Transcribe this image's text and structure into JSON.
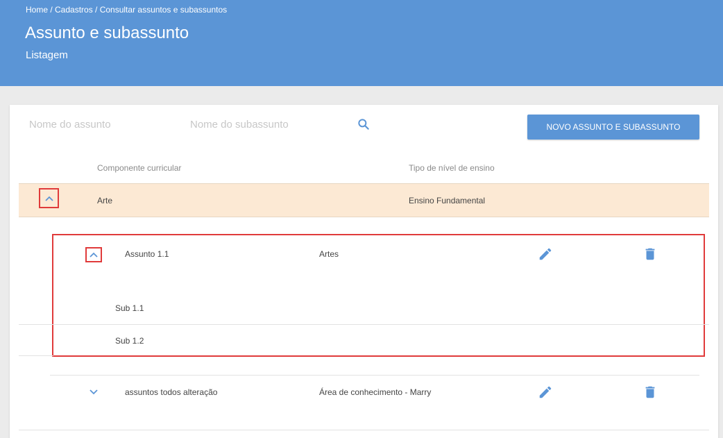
{
  "header": {
    "breadcrumb": "Home / Cadastros / Consultar assuntos e subassuntos",
    "title": "Assunto e subassunto",
    "subtitle": "Listagem"
  },
  "filters": {
    "assunto_placeholder": "Nome do assunto",
    "subassunto_placeholder": "Nome do subassunto",
    "new_button_label": "NOVO ASSUNTO E SUBASSUNTO"
  },
  "table": {
    "columns": [
      "Componente curricular",
      "Tipo de nível de ensino"
    ],
    "group": {
      "componente": "Arte",
      "tipo": "Ensino Fundamental",
      "assuntos": [
        {
          "name": "Assunto 1.1",
          "area": "Artes",
          "expanded": true,
          "subassuntos": [
            "Sub 1.1",
            "Sub 1.2"
          ]
        },
        {
          "name": "assuntos todos alteração",
          "area": "Área de conhecimento - Marry",
          "expanded": false,
          "subassuntos": []
        }
      ]
    }
  },
  "icons": {
    "search": "search-icon",
    "expand": "chevron-up-icon",
    "collapse": "chevron-down-icon",
    "edit": "pencil-icon",
    "delete": "trash-icon"
  },
  "colors": {
    "primary": "#5b95d6",
    "highlight_row": "#fce9d4",
    "annotation": "#e03a3a"
  }
}
